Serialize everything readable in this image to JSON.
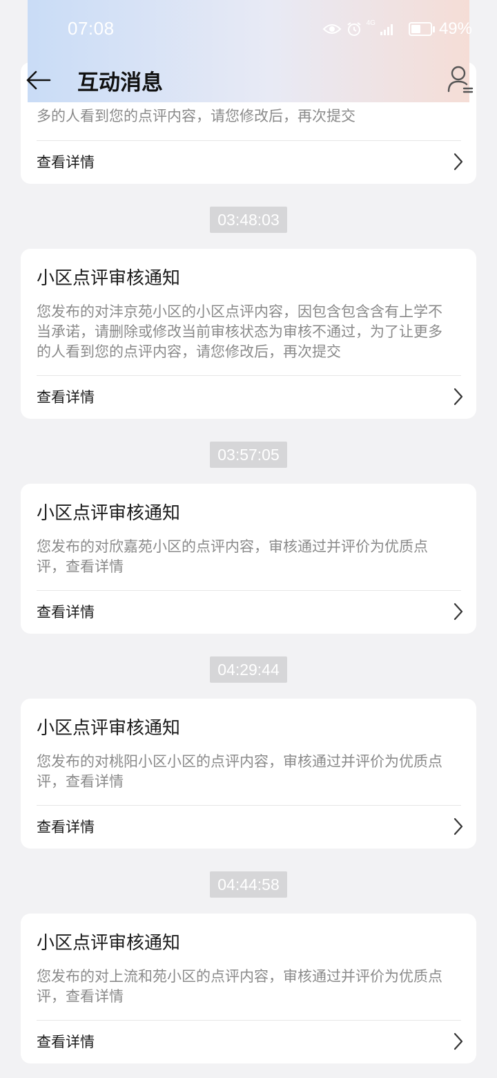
{
  "status": {
    "time": "07:08",
    "battery": "49%",
    "network": "4G"
  },
  "header": {
    "title": "互动消息"
  },
  "partial_card": {
    "body_visible": "多的人看到您的点评内容，请您修改后，再次提交",
    "link_label": "查看详情"
  },
  "messages": [
    {
      "time": "03:48:03",
      "title": "小区点评审核通知",
      "body_lines": [
        "您发布的对沣京苑小区的小区点评内容，因包含包含含有上学不",
        "当承诺，请删除或修改当前审核状态为审核不通过，为了让更多",
        "的人看到您的点评内容，请您修改后，再次提交"
      ],
      "link_label": "查看详情"
    },
    {
      "time": "03:57:05",
      "title": "小区点评审核通知",
      "body_lines": [
        "您发布的对欣嘉苑小区的点评内容，审核通过并评价为优质点",
        "评，查看详情"
      ],
      "link_label": "查看详情"
    },
    {
      "time": "04:29:44",
      "title": "小区点评审核通知",
      "body_lines": [
        "您发布的对桃阳小区小区的点评内容，审核通过并评价为优质点",
        "评，查看详情"
      ],
      "link_label": "查看详情"
    },
    {
      "time": "04:44:58",
      "title": "小区点评审核通知",
      "body_lines": [
        "您发布的对上流和苑小区的点评内容，审核通过并评价为优质点",
        "评，查看详情"
      ],
      "link_label": "查看详情"
    }
  ]
}
